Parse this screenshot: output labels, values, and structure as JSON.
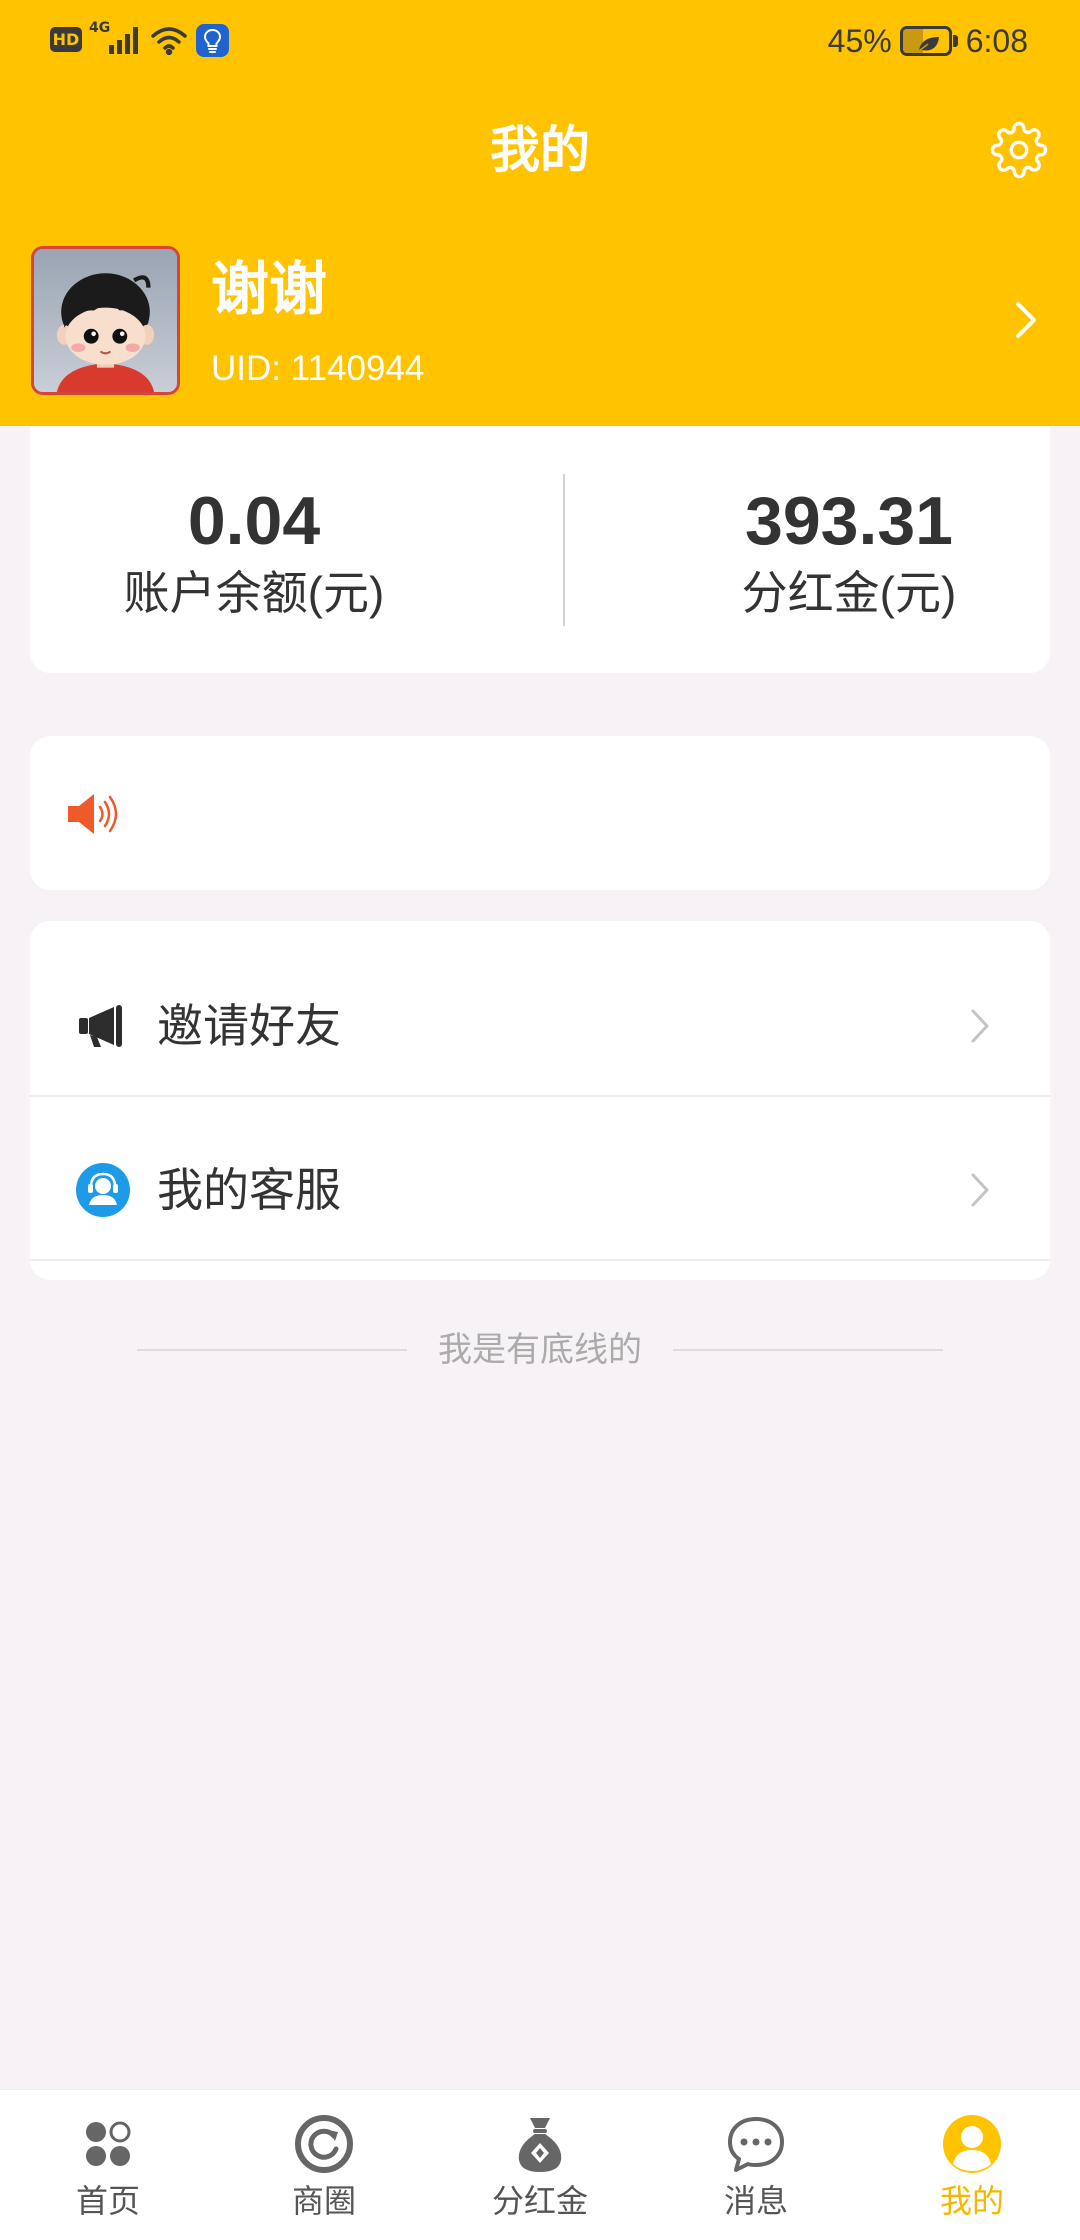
{
  "status_bar": {
    "hd_badge": "HD",
    "network_type": "4G",
    "battery_percent": "45%",
    "battery_level": 0.45,
    "time": "6:08",
    "icons": [
      "signal-icon",
      "wifi-icon",
      "lightbulb-icon",
      "battery-saver-icon"
    ]
  },
  "header": {
    "title": "我的",
    "settings_icon": "gear-icon"
  },
  "profile": {
    "name": "谢谢",
    "uid": "UID: 1140944",
    "avatar": "cartoon-boy-avatar",
    "chevron_icon": "chevron-right-icon"
  },
  "stats": [
    {
      "value": "0.04",
      "label": "账户余额(元)"
    },
    {
      "value": "393.31",
      "label": "分红金(元)"
    }
  ],
  "notice": {
    "icon": "speaker-icon"
  },
  "menu": [
    {
      "label": "邀请好友",
      "icon": "megaphone-icon"
    },
    {
      "label": "我的客服",
      "icon": "customer-service-icon"
    }
  ],
  "footer": {
    "end_text": "我是有底线的"
  },
  "bottom_nav": {
    "active_index": 4,
    "items": [
      {
        "label": "首页",
        "icon": "home-dots-icon"
      },
      {
        "label": "商圈",
        "icon": "business-circle-icon"
      },
      {
        "label": "分红金",
        "icon": "money-bag-icon"
      },
      {
        "label": "消息",
        "icon": "chat-bubble-icon"
      },
      {
        "label": "我的",
        "icon": "user-icon"
      }
    ]
  },
  "colors": {
    "accent": "#FFC300",
    "nav_active": "#F5B700",
    "page_background": "#F7F2F5",
    "service_icon_blue": "#1D9BE8",
    "speaker_red": "#F05A2A"
  }
}
